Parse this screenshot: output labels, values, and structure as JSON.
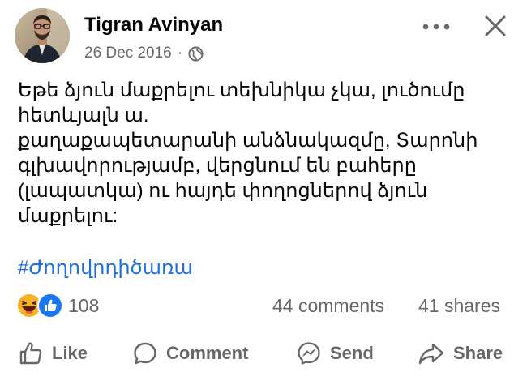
{
  "author": {
    "name": "Tigran Avinyan",
    "date": "26 Dec 2016",
    "separator": "·",
    "privacy_icon": "globe-icon"
  },
  "header": {
    "more_icon": "more-horizontal-icon",
    "close_icon": "close-icon"
  },
  "post": {
    "lines": [
      "Եթե ձյուն մաքրելու տեխնիկա չկա, լուծումը",
      "հետևյալն ա.",
      "քաղաքապետարանի անձնակազմը, Տարոնի",
      "գլխավորությամբ, վերցնում են բահերը",
      "(լապատկա) ու հայդե փողոցներով ձյուն",
      "մաքրելու:"
    ],
    "hashtag": "#Ժողովրդիծառա"
  },
  "reactions": {
    "icons": [
      "haha-icon",
      "like-icon"
    ],
    "count": "108",
    "comments": "44 comments",
    "shares": "41 shares"
  },
  "actions": {
    "like": "Like",
    "comment": "Comment",
    "send": "Send",
    "share": "Share"
  },
  "colors": {
    "text": "#050505",
    "secondary": "#65676b",
    "link": "#216fdb",
    "like_blue": "#1877f2",
    "haha_yellow": "#f7b125"
  }
}
